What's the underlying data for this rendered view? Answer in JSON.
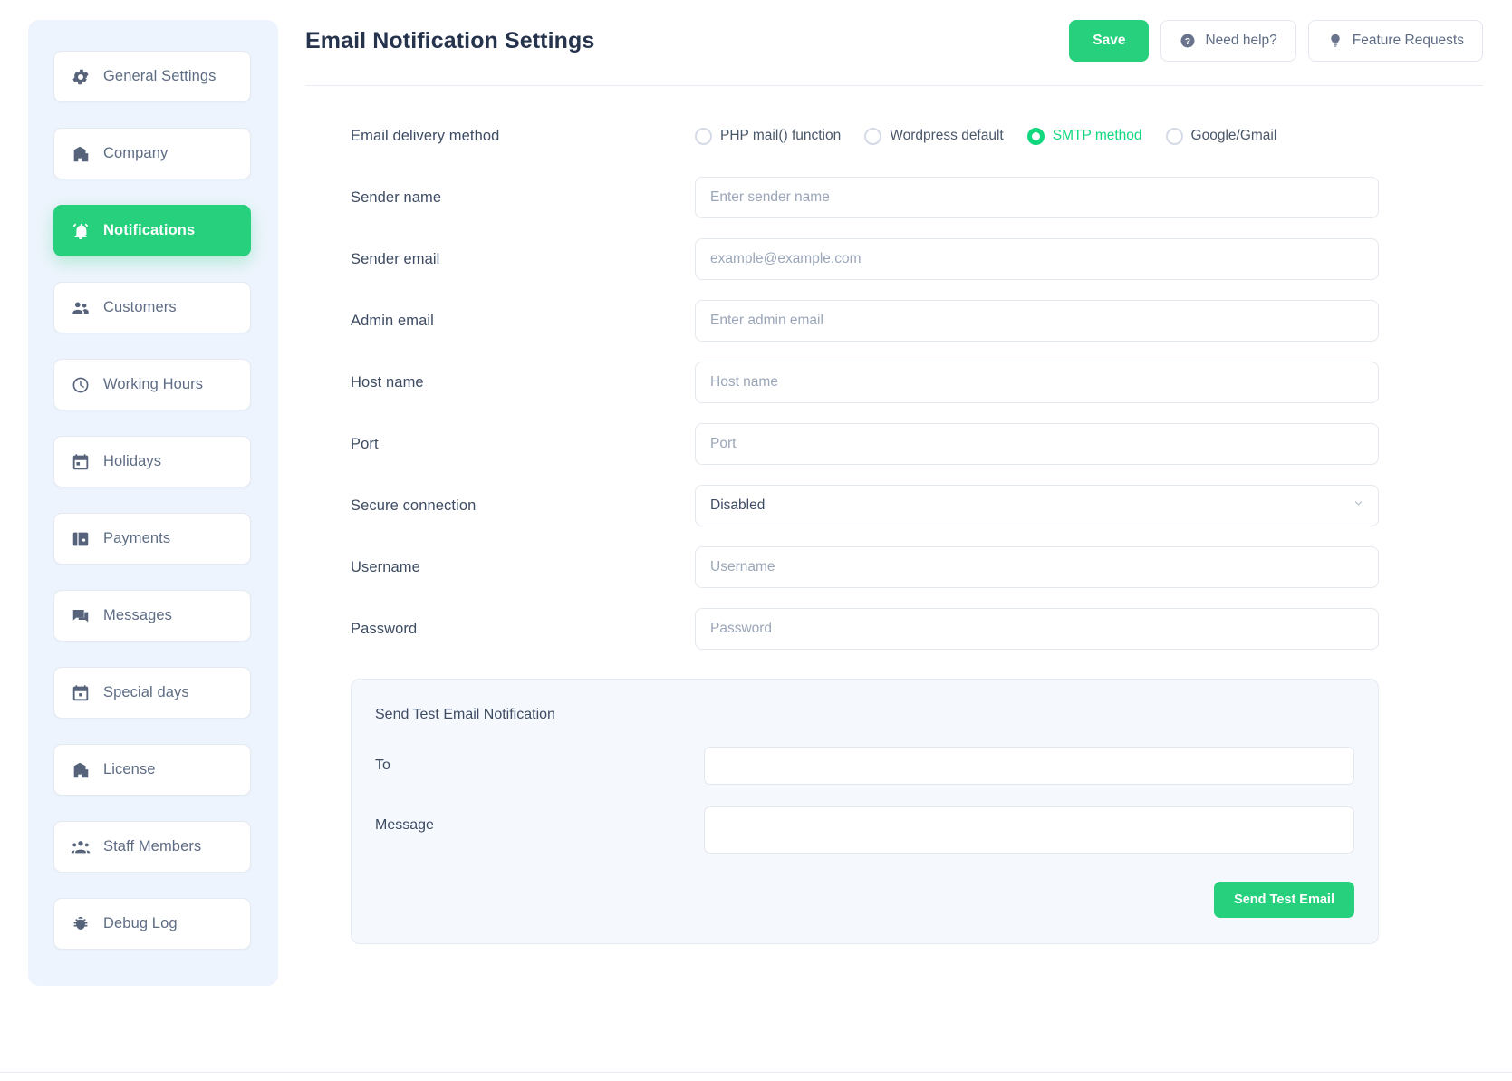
{
  "header": {
    "title": "Email Notification Settings",
    "save_label": "Save",
    "need_help_label": "Need help?",
    "feature_requests_label": "Feature Requests",
    "accent_color": "#26d07c"
  },
  "sidebar": {
    "items": [
      {
        "label": "General Settings",
        "icon": "gear-icon",
        "active": false
      },
      {
        "label": "Company",
        "icon": "building-icon",
        "active": false
      },
      {
        "label": "Notifications",
        "icon": "bell-icon",
        "active": true
      },
      {
        "label": "Customers",
        "icon": "people-icon",
        "active": false
      },
      {
        "label": "Working Hours",
        "icon": "clock-icon",
        "active": false
      },
      {
        "label": "Holidays",
        "icon": "calendar-icon",
        "active": false
      },
      {
        "label": "Payments",
        "icon": "wallet-icon",
        "active": false
      },
      {
        "label": "Messages",
        "icon": "chat-icon",
        "active": false
      },
      {
        "label": "Special days",
        "icon": "calendar-star-icon",
        "active": false
      },
      {
        "label": "License",
        "icon": "building-icon",
        "active": false
      },
      {
        "label": "Staff Members",
        "icon": "group-icon",
        "active": false
      },
      {
        "label": "Debug Log",
        "icon": "bug-icon",
        "active": false
      }
    ]
  },
  "form": {
    "delivery_method": {
      "label": "Email delivery method",
      "options": [
        {
          "label": "PHP mail() function",
          "checked": false
        },
        {
          "label": "Wordpress default",
          "checked": false
        },
        {
          "label": "SMTP method",
          "checked": true
        },
        {
          "label": "Google/Gmail",
          "checked": false
        }
      ]
    },
    "fields": [
      {
        "label": "Sender name",
        "placeholder": "Enter sender name",
        "value": "",
        "type": "text"
      },
      {
        "label": "Sender email",
        "placeholder": "example@example.com",
        "value": "",
        "type": "text"
      },
      {
        "label": "Admin email",
        "placeholder": "Enter admin email",
        "value": "",
        "type": "text"
      },
      {
        "label": "Host name",
        "placeholder": "Host name",
        "value": "",
        "type": "text"
      },
      {
        "label": "Port",
        "placeholder": "Port",
        "value": "",
        "type": "text"
      },
      {
        "label": "Secure connection",
        "placeholder": "",
        "value": "Disabled",
        "type": "select"
      },
      {
        "label": "Username",
        "placeholder": "Username",
        "value": "",
        "type": "text"
      },
      {
        "label": "Password",
        "placeholder": "Password",
        "value": "",
        "type": "text"
      }
    ]
  },
  "test_panel": {
    "title": "Send Test Email Notification",
    "to_label": "To",
    "to_value": "",
    "message_label": "Message",
    "message_value": "",
    "send_label": "Send Test Email"
  }
}
